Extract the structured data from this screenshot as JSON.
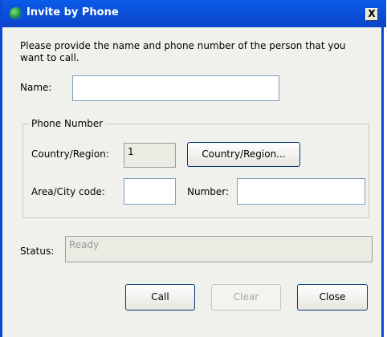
{
  "window": {
    "title": "Invite by Phone",
    "close_label": "X"
  },
  "instructions": "Please provide the name and phone number of the person that you want to call.",
  "name": {
    "label": "Name:",
    "value": ""
  },
  "phone_group": {
    "legend": "Phone Number",
    "country_label": "Country/Region:",
    "country_value": "1",
    "country_button": "Country/Region...",
    "area_label": "Area/City code:",
    "area_value": "",
    "number_label": "Number:",
    "number_value": ""
  },
  "status": {
    "label": "Status:",
    "value": "Ready"
  },
  "buttons": {
    "call": "Call",
    "clear": "Clear",
    "close": "Close"
  }
}
